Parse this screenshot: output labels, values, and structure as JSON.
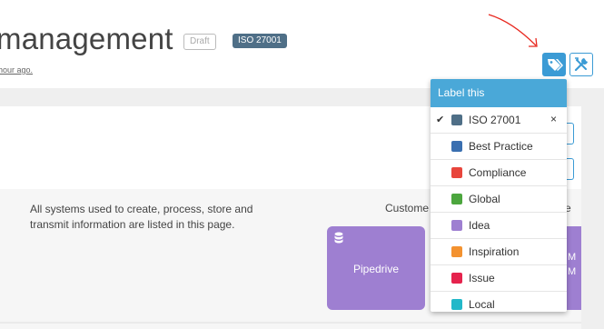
{
  "header": {
    "title": "management",
    "draft_badge": "Draft",
    "iso_badge": "ISO 27001",
    "subtitle": "hour ago."
  },
  "toolbar": {
    "tag_icon": "tag-icon",
    "tools_icon": "tools-icon"
  },
  "content": {
    "description": "All systems used to create, process, store and transmit information are listed in this page.",
    "column_partial_1": "Custome",
    "column_partial_2": "e",
    "system_card": {
      "label": "Pipedrive",
      "icon": "database-icon"
    },
    "partial_card_letters": [
      "M",
      "M"
    ]
  },
  "label_dropdown": {
    "header": "Label this",
    "remove_symbol": "×",
    "check_symbol": "✔",
    "items": [
      {
        "label": "ISO 27001",
        "color": "#4f6f87",
        "checked": true
      },
      {
        "label": "Best Practice",
        "color": "#3a6fb0",
        "checked": false
      },
      {
        "label": "Compliance",
        "color": "#e8453c",
        "checked": false
      },
      {
        "label": "Global",
        "color": "#4ca63e",
        "checked": false
      },
      {
        "label": "Idea",
        "color": "#9e7fd1",
        "checked": false
      },
      {
        "label": "Inspiration",
        "color": "#f39230",
        "checked": false
      },
      {
        "label": "Issue",
        "color": "#e5234d",
        "checked": false
      },
      {
        "label": "Local",
        "color": "#22b8c9",
        "checked": false
      }
    ]
  },
  "colors": {
    "accent": "#3b9bd5",
    "dropdown_header": "#4aa8d8",
    "annotation_arrow": "#e8271e"
  }
}
